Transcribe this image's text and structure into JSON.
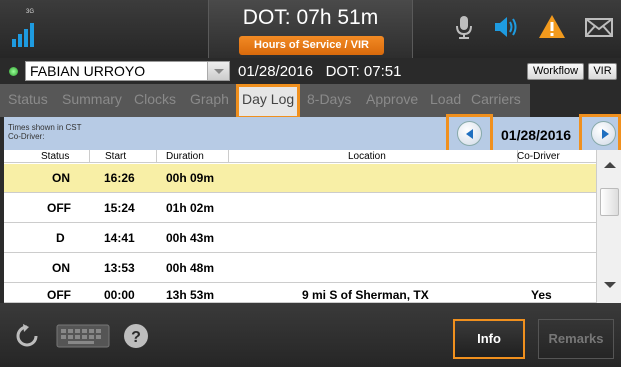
{
  "topbar": {
    "signal_label": "3G",
    "dot_title": "DOT: 07h 51m",
    "hos_button": "Hours of Service / VIR"
  },
  "driver_row": {
    "driver_name": "FABIAN URROYO",
    "date_dot": "01/28/2016   DOT: 07:51",
    "workflow_button": "Workflow",
    "vir_button": "VIR"
  },
  "tabs": [
    "Status",
    "Summary",
    "Clocks",
    "Graph",
    "Day Log",
    "8-Days",
    "Approve",
    "Load",
    "Carriers"
  ],
  "active_tab": "Day Log",
  "info_bar": {
    "timezone_note": "Times shown in CST",
    "co_driver_note": "Co-Driver:",
    "current_date": "01/28/2016"
  },
  "table": {
    "headers": [
      "Status",
      "Start",
      "Duration",
      "Location",
      "Co-Driver"
    ],
    "rows": [
      {
        "status": "ON",
        "start": "16:26",
        "duration": "00h 09m",
        "location": "",
        "co_driver": ""
      },
      {
        "status": "OFF",
        "start": "15:24",
        "duration": "01h 02m",
        "location": "",
        "co_driver": ""
      },
      {
        "status": "D",
        "start": "14:41",
        "duration": "00h 43m",
        "location": "",
        "co_driver": ""
      },
      {
        "status": "ON",
        "start": "13:53",
        "duration": "00h 48m",
        "location": "",
        "co_driver": ""
      },
      {
        "status": "OFF",
        "start": "00:00",
        "duration": "13h 53m",
        "location": "9 mi S of Sherman, TX",
        "co_driver": "Yes"
      }
    ]
  },
  "bottombar": {
    "info_button": "Info",
    "remarks_button": "Remarks"
  },
  "colors": {
    "accent_orange": "#f0901e",
    "selected_row": "#f8efa6",
    "info_bar_bg": "#b7cbe5",
    "signal_blue": "#1e9be0",
    "warning_orange": "#f29a1d"
  },
  "icons": [
    "signal-icon",
    "microphone-icon",
    "speaker-icon",
    "warning-icon",
    "mail-icon",
    "refresh-icon",
    "keyboard-icon",
    "help-icon"
  ]
}
